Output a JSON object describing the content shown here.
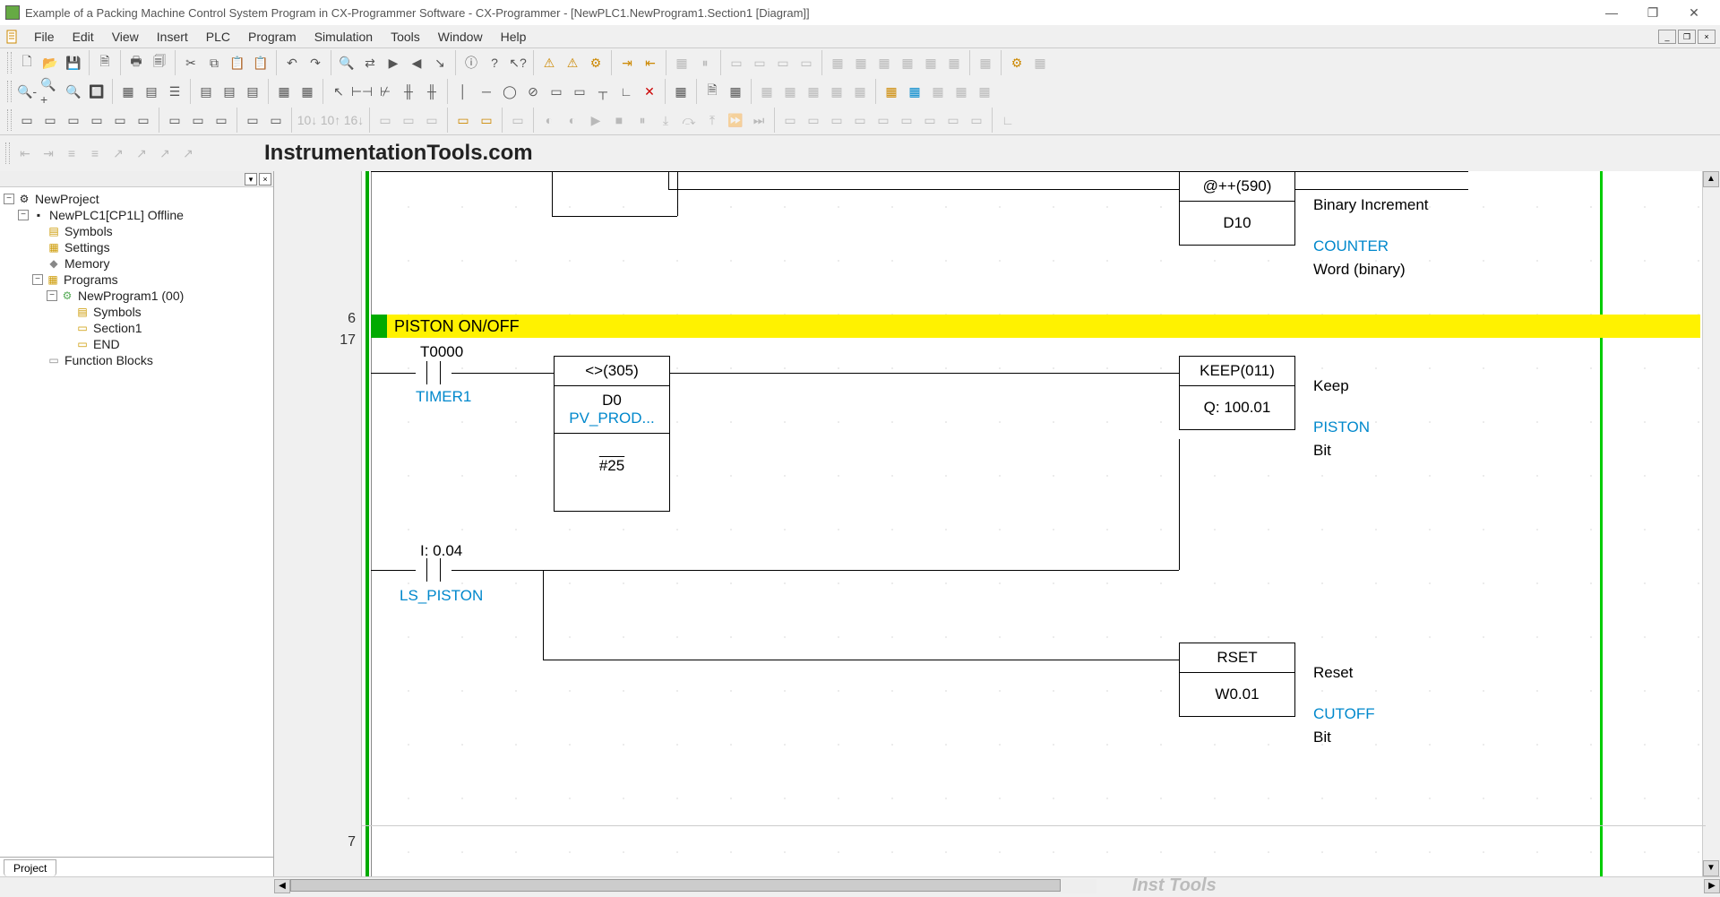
{
  "title": "Example of a Packing Machine Control System Program in CX-Programmer Software - CX-Programmer - [NewPLC1.NewProgram1.Section1 [Diagram]]",
  "menu": [
    "File",
    "Edit",
    "View",
    "Insert",
    "PLC",
    "Program",
    "Simulation",
    "Tools",
    "Window",
    "Help"
  ],
  "watermark": "InstrumentationTools.com",
  "watermark2": "Inst Tools",
  "sidebar": {
    "tab": "Project",
    "tree": {
      "root": "NewProject",
      "plc": "NewPLC1[CP1L] Offline",
      "symbols": "Symbols",
      "settings": "Settings",
      "memory": "Memory",
      "programs": "Programs",
      "program1": "NewProgram1 (00)",
      "p_symbols": "Symbols",
      "section1": "Section1",
      "end": "END",
      "fb": "Function Blocks"
    }
  },
  "ladder": {
    "rung_top_idx": "6",
    "rung_top_step": "17",
    "rung_bottom_idx": "7",
    "section_title": "PISTON ON/OFF",
    "block1": {
      "op": "@++(590)",
      "arg": "D10"
    },
    "anno1": {
      "title": "Binary Increment",
      "sym": "COUNTER",
      "type": "Word (binary)"
    },
    "contact1": {
      "addr": "T0000",
      "sym": "TIMER1"
    },
    "cmp": {
      "op": "<>(305)",
      "a1": "D0",
      "a1s": "PV_PROD...",
      "a2": "#25"
    },
    "keep": {
      "op": "KEEP(011)",
      "out": "Q: 100.01"
    },
    "anno2": {
      "title": "Keep",
      "sym": "PISTON",
      "type": "Bit"
    },
    "contact2": {
      "addr": "I: 0.04",
      "sym": "LS_PISTON"
    },
    "rset": {
      "op": "RSET",
      "out": "W0.01"
    },
    "anno3": {
      "title": "Reset",
      "sym": "CUTOFF",
      "type": "Bit"
    }
  }
}
